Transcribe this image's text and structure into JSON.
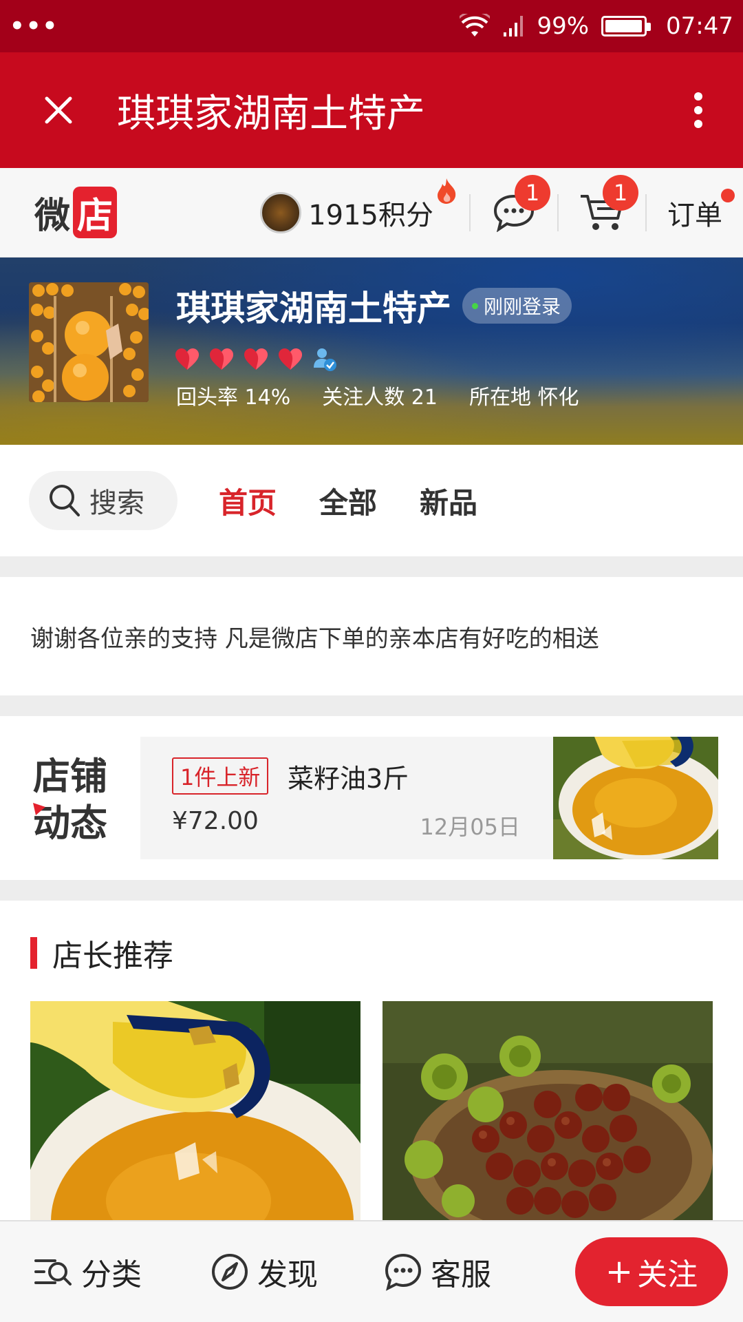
{
  "status_bar": {
    "dots": "•••",
    "battery": "99%",
    "battery_level": 0.99,
    "time": "07:47"
  },
  "title_bar": {
    "title": "琪琪家湖南土特产",
    "close_icon": "close-icon",
    "more_icon": "more-vertical-icon"
  },
  "shop_bar": {
    "logo_part1": "微",
    "logo_part2": "店",
    "points": "1915积分",
    "messages_badge": "1",
    "cart_badge": "1",
    "orders_label": "订单"
  },
  "shop_info": {
    "name": "琪琪家湖南土特产",
    "online_status": "刚刚登录",
    "heart_count": 4,
    "stats": [
      {
        "label": "回头率",
        "value": "14%"
      },
      {
        "label": "关注人数",
        "value": "21"
      },
      {
        "label": "所在地",
        "value": "怀化"
      }
    ]
  },
  "nav": {
    "search_label": "搜索",
    "tabs": [
      {
        "label": "首页",
        "active": true
      },
      {
        "label": "全部",
        "active": false
      },
      {
        "label": "新品",
        "active": false
      }
    ]
  },
  "notice": {
    "text": "谢谢各位亲的支持 凡是微店下单的亲本店有好吃的相送"
  },
  "dynamics": {
    "title_line1": "店铺",
    "title_line2": "动态",
    "tag": "1件上新",
    "product_name": "菜籽油3斤",
    "price": "¥72.00",
    "date": "12月05日"
  },
  "recommend": {
    "title": "店长推荐"
  },
  "bottom_bar": {
    "category_label": "分类",
    "discover_label": "发现",
    "service_label": "客服",
    "follow_label": "关注",
    "follow_prefix": "+"
  },
  "colors": {
    "brand_red": "#c70a1e",
    "status_red": "#a30019",
    "accent_red": "#e3232f"
  }
}
